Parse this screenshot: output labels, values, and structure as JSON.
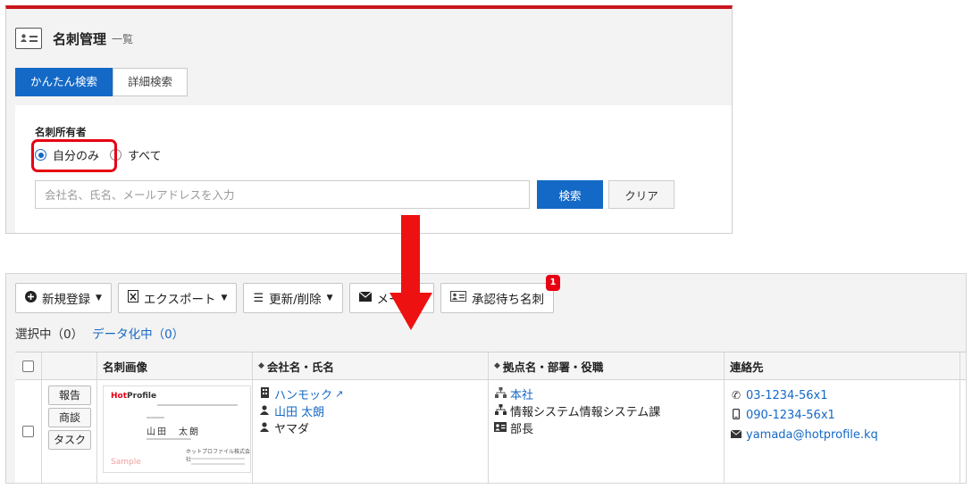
{
  "header": {
    "title": "名刺管理",
    "subtitle": "一覧"
  },
  "search": {
    "tabs": [
      {
        "label": "かんたん検索",
        "active": true
      },
      {
        "label": "詳細検索",
        "active": false
      }
    ],
    "owner_label": "名刺所有者",
    "owner_options": [
      {
        "label": "自分のみ",
        "selected": true
      },
      {
        "label": "すべて",
        "selected": false
      }
    ],
    "placeholder": "会社名、氏名、メールアドレスを入力",
    "value": "",
    "search_button": "検索",
    "clear_button": "クリア"
  },
  "toolbar": {
    "new_register": "新規登録",
    "export": "エクスポート",
    "update_delete": "更新/削除",
    "mail": "メール",
    "approval": "承認待ち名刺",
    "approval_badge": "1"
  },
  "selection": {
    "selected": "選択中（0）",
    "data_pending": "データ化中（0）"
  },
  "table": {
    "headers": {
      "card_image": "名刺画像",
      "company_name": "会社名・氏名",
      "location": "拠点名・部署・役職",
      "contact": "連絡先"
    },
    "rows": [
      {
        "actions": [
          "報告",
          "商談",
          "タスク"
        ],
        "card": {
          "logo_hot": "Hot",
          "logo_rest": "Profile",
          "name": "山田　太朗",
          "company": "ホットプロファイル株式会社",
          "watermark": "Sample"
        },
        "company": "ハンモック",
        "person": "山田 太朗",
        "person_kana": "ヤマダ",
        "location": "本社",
        "department": "情報システム情報システム課",
        "position": "部長",
        "phone": "03-1234-56x1",
        "mobile": "090-1234-56x1",
        "email": "yamada@hotprofile.kq"
      }
    ]
  },
  "colors": {
    "primary": "#1469c6",
    "accent_red": "#e60012",
    "header_bar": "#c8161d"
  },
  "icons": {
    "title": "business-card-icon",
    "new": "plus-circle-icon",
    "export": "excel-file-icon",
    "update": "list-icon",
    "mail": "envelope-icon",
    "approval": "business-card-icon"
  }
}
